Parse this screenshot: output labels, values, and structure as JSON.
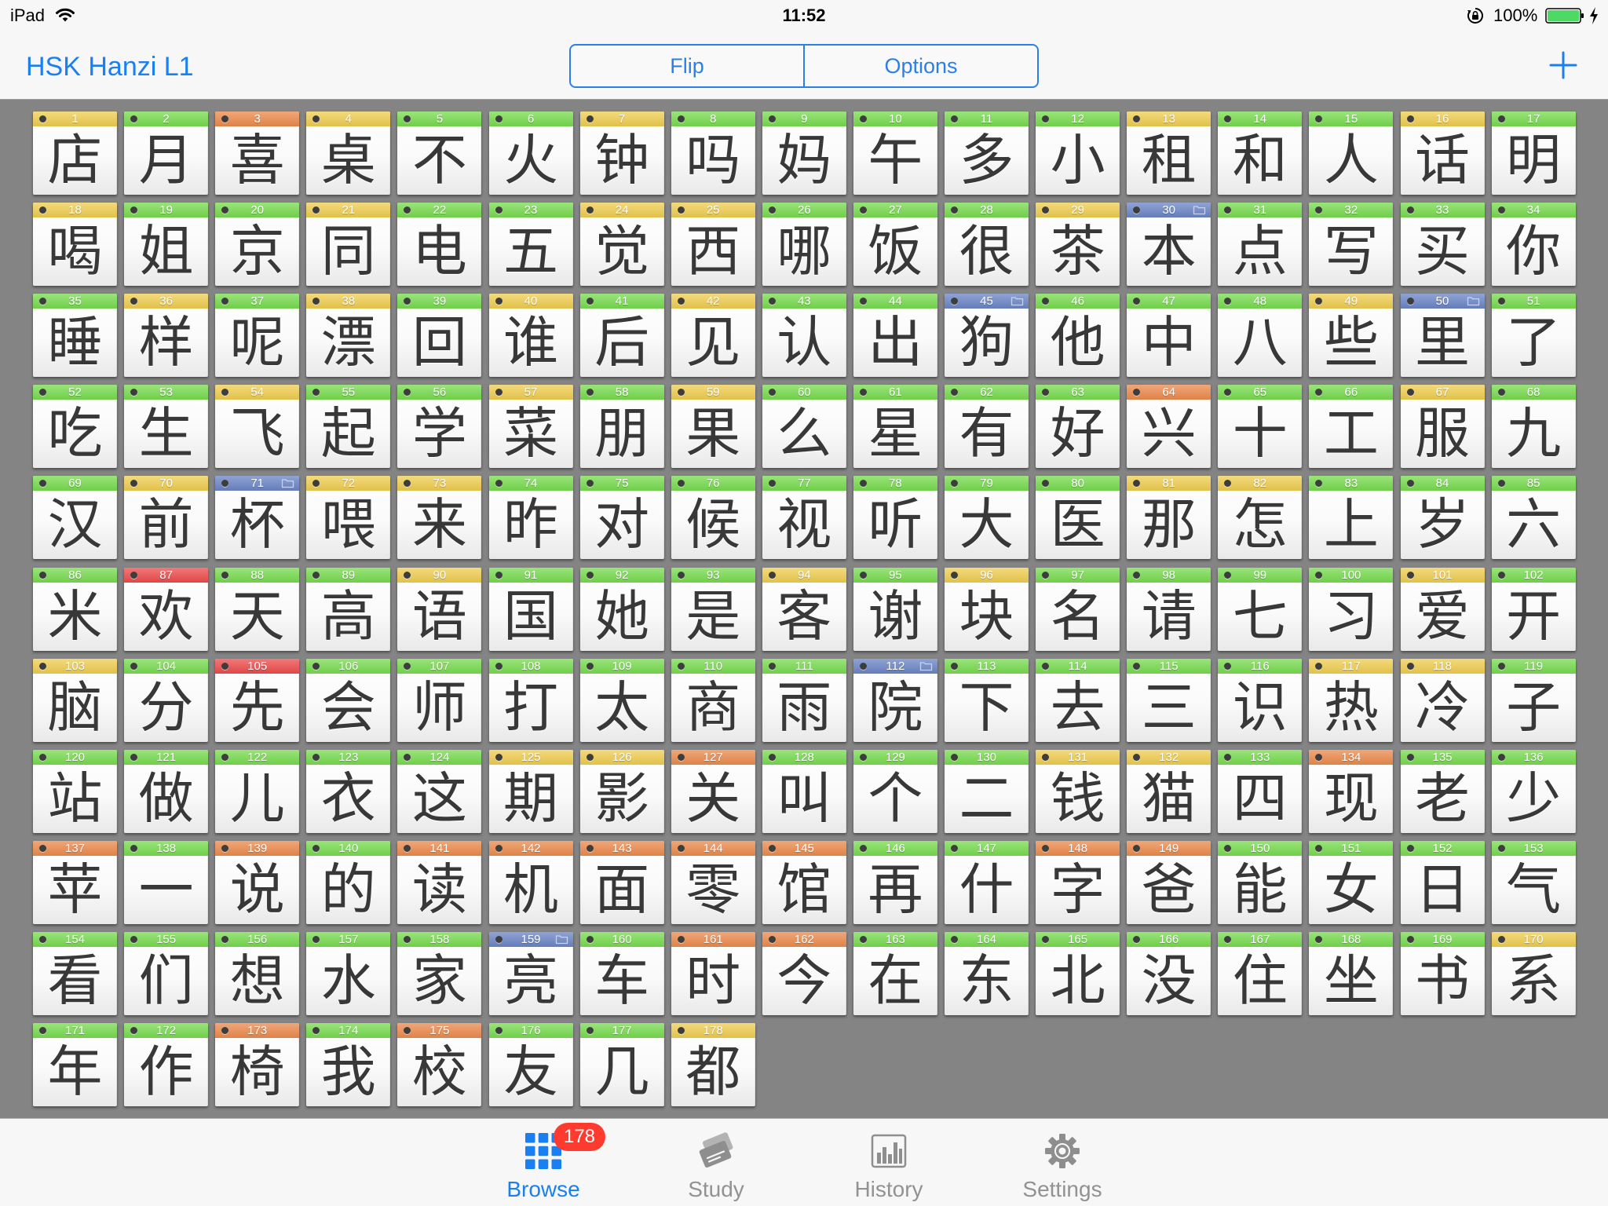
{
  "status_bar": {
    "device": "iPad",
    "time": "11:52",
    "battery": "100%",
    "wifi_icon": "wifi-icon",
    "lock_icon": "rotation-lock-icon",
    "battery_icon": "battery-icon",
    "charging_icon": "bolt-icon"
  },
  "nav": {
    "title": "HSK Hanzi L1",
    "segments": [
      {
        "label": "Flip"
      },
      {
        "label": "Options"
      }
    ],
    "add_icon": "plus-icon"
  },
  "theme": {
    "accent": "#1a7ff0",
    "badge": "#ff3b30",
    "grid_background": "#848484"
  },
  "status_colors": {
    "green": "#77db4e",
    "yellow": "#efcd50",
    "orange": "#ec8a4c",
    "red": "#ee4b4b",
    "blue": "#6a84c6"
  },
  "card_marker": {
    "status": "blue",
    "icon": "folder-icon"
  },
  "cards": [
    {
      "num": "1",
      "char": "店",
      "status": "yellow"
    },
    {
      "num": "2",
      "char": "月",
      "status": "green"
    },
    {
      "num": "3",
      "char": "喜",
      "status": "orange"
    },
    {
      "num": "4",
      "char": "桌",
      "status": "yellow"
    },
    {
      "num": "5",
      "char": "不",
      "status": "green"
    },
    {
      "num": "6",
      "char": "火",
      "status": "green"
    },
    {
      "num": "7",
      "char": "钟",
      "status": "yellow"
    },
    {
      "num": "8",
      "char": "吗",
      "status": "green"
    },
    {
      "num": "9",
      "char": "妈",
      "status": "green"
    },
    {
      "num": "10",
      "char": "午",
      "status": "green"
    },
    {
      "num": "11",
      "char": "多",
      "status": "green"
    },
    {
      "num": "12",
      "char": "小",
      "status": "green"
    },
    {
      "num": "13",
      "char": "租",
      "status": "yellow"
    },
    {
      "num": "14",
      "char": "和",
      "status": "green"
    },
    {
      "num": "15",
      "char": "人",
      "status": "green"
    },
    {
      "num": "16",
      "char": "话",
      "status": "yellow"
    },
    {
      "num": "17",
      "char": "明",
      "status": "green"
    },
    {
      "num": "18",
      "char": "喝",
      "status": "yellow"
    },
    {
      "num": "19",
      "char": "姐",
      "status": "green"
    },
    {
      "num": "20",
      "char": "京",
      "status": "green"
    },
    {
      "num": "21",
      "char": "同",
      "status": "yellow"
    },
    {
      "num": "22",
      "char": "电",
      "status": "green"
    },
    {
      "num": "23",
      "char": "五",
      "status": "green"
    },
    {
      "num": "24",
      "char": "觉",
      "status": "yellow"
    },
    {
      "num": "25",
      "char": "西",
      "status": "yellow"
    },
    {
      "num": "26",
      "char": "哪",
      "status": "green"
    },
    {
      "num": "27",
      "char": "饭",
      "status": "green"
    },
    {
      "num": "28",
      "char": "很",
      "status": "green"
    },
    {
      "num": "29",
      "char": "茶",
      "status": "yellow"
    },
    {
      "num": "30",
      "char": "本",
      "status": "blue"
    },
    {
      "num": "31",
      "char": "点",
      "status": "green"
    },
    {
      "num": "32",
      "char": "写",
      "status": "green"
    },
    {
      "num": "33",
      "char": "买",
      "status": "green"
    },
    {
      "num": "34",
      "char": "你",
      "status": "green"
    },
    {
      "num": "35",
      "char": "睡",
      "status": "green"
    },
    {
      "num": "36",
      "char": "样",
      "status": "yellow"
    },
    {
      "num": "37",
      "char": "呢",
      "status": "green"
    },
    {
      "num": "38",
      "char": "漂",
      "status": "yellow"
    },
    {
      "num": "39",
      "char": "回",
      "status": "green"
    },
    {
      "num": "40",
      "char": "谁",
      "status": "yellow"
    },
    {
      "num": "41",
      "char": "后",
      "status": "green"
    },
    {
      "num": "42",
      "char": "见",
      "status": "yellow"
    },
    {
      "num": "43",
      "char": "认",
      "status": "green"
    },
    {
      "num": "44",
      "char": "出",
      "status": "green"
    },
    {
      "num": "45",
      "char": "狗",
      "status": "blue"
    },
    {
      "num": "46",
      "char": "他",
      "status": "green"
    },
    {
      "num": "47",
      "char": "中",
      "status": "green"
    },
    {
      "num": "48",
      "char": "八",
      "status": "green"
    },
    {
      "num": "49",
      "char": "些",
      "status": "yellow"
    },
    {
      "num": "50",
      "char": "里",
      "status": "blue"
    },
    {
      "num": "51",
      "char": "了",
      "status": "green"
    },
    {
      "num": "52",
      "char": "吃",
      "status": "green"
    },
    {
      "num": "53",
      "char": "生",
      "status": "green"
    },
    {
      "num": "54",
      "char": "飞",
      "status": "yellow"
    },
    {
      "num": "55",
      "char": "起",
      "status": "green"
    },
    {
      "num": "56",
      "char": "学",
      "status": "green"
    },
    {
      "num": "57",
      "char": "菜",
      "status": "yellow"
    },
    {
      "num": "58",
      "char": "朋",
      "status": "green"
    },
    {
      "num": "59",
      "char": "果",
      "status": "yellow"
    },
    {
      "num": "60",
      "char": "么",
      "status": "green"
    },
    {
      "num": "61",
      "char": "星",
      "status": "green"
    },
    {
      "num": "62",
      "char": "有",
      "status": "green"
    },
    {
      "num": "63",
      "char": "好",
      "status": "green"
    },
    {
      "num": "64",
      "char": "兴",
      "status": "orange"
    },
    {
      "num": "65",
      "char": "十",
      "status": "green"
    },
    {
      "num": "66",
      "char": "工",
      "status": "green"
    },
    {
      "num": "67",
      "char": "服",
      "status": "yellow"
    },
    {
      "num": "68",
      "char": "九",
      "status": "green"
    },
    {
      "num": "69",
      "char": "汉",
      "status": "green"
    },
    {
      "num": "70",
      "char": "前",
      "status": "yellow"
    },
    {
      "num": "71",
      "char": "杯",
      "status": "blue"
    },
    {
      "num": "72",
      "char": "喂",
      "status": "yellow"
    },
    {
      "num": "73",
      "char": "来",
      "status": "yellow"
    },
    {
      "num": "74",
      "char": "昨",
      "status": "green"
    },
    {
      "num": "75",
      "char": "对",
      "status": "green"
    },
    {
      "num": "76",
      "char": "候",
      "status": "green"
    },
    {
      "num": "77",
      "char": "视",
      "status": "green"
    },
    {
      "num": "78",
      "char": "听",
      "status": "green"
    },
    {
      "num": "79",
      "char": "大",
      "status": "green"
    },
    {
      "num": "80",
      "char": "医",
      "status": "green"
    },
    {
      "num": "81",
      "char": "那",
      "status": "yellow"
    },
    {
      "num": "82",
      "char": "怎",
      "status": "yellow"
    },
    {
      "num": "83",
      "char": "上",
      "status": "green"
    },
    {
      "num": "84",
      "char": "岁",
      "status": "green"
    },
    {
      "num": "85",
      "char": "六",
      "status": "green"
    },
    {
      "num": "86",
      "char": "米",
      "status": "green"
    },
    {
      "num": "87",
      "char": "欢",
      "status": "red"
    },
    {
      "num": "88",
      "char": "天",
      "status": "green"
    },
    {
      "num": "89",
      "char": "高",
      "status": "green"
    },
    {
      "num": "90",
      "char": "语",
      "status": "yellow"
    },
    {
      "num": "91",
      "char": "国",
      "status": "green"
    },
    {
      "num": "92",
      "char": "她",
      "status": "green"
    },
    {
      "num": "93",
      "char": "是",
      "status": "green"
    },
    {
      "num": "94",
      "char": "客",
      "status": "yellow"
    },
    {
      "num": "95",
      "char": "谢",
      "status": "green"
    },
    {
      "num": "96",
      "char": "块",
      "status": "yellow"
    },
    {
      "num": "97",
      "char": "名",
      "status": "green"
    },
    {
      "num": "98",
      "char": "请",
      "status": "green"
    },
    {
      "num": "99",
      "char": "七",
      "status": "green"
    },
    {
      "num": "100",
      "char": "习",
      "status": "green"
    },
    {
      "num": "101",
      "char": "爱",
      "status": "yellow"
    },
    {
      "num": "102",
      "char": "开",
      "status": "green"
    },
    {
      "num": "103",
      "char": "脑",
      "status": "yellow"
    },
    {
      "num": "104",
      "char": "分",
      "status": "green"
    },
    {
      "num": "105",
      "char": "先",
      "status": "red"
    },
    {
      "num": "106",
      "char": "会",
      "status": "green"
    },
    {
      "num": "107",
      "char": "师",
      "status": "green"
    },
    {
      "num": "108",
      "char": "打",
      "status": "green"
    },
    {
      "num": "109",
      "char": "太",
      "status": "green"
    },
    {
      "num": "110",
      "char": "商",
      "status": "green"
    },
    {
      "num": "111",
      "char": "雨",
      "status": "green"
    },
    {
      "num": "112",
      "char": "院",
      "status": "blue"
    },
    {
      "num": "113",
      "char": "下",
      "status": "green"
    },
    {
      "num": "114",
      "char": "去",
      "status": "green"
    },
    {
      "num": "115",
      "char": "三",
      "status": "green"
    },
    {
      "num": "116",
      "char": "识",
      "status": "green"
    },
    {
      "num": "117",
      "char": "热",
      "status": "yellow"
    },
    {
      "num": "118",
      "char": "冷",
      "status": "yellow"
    },
    {
      "num": "119",
      "char": "子",
      "status": "green"
    },
    {
      "num": "120",
      "char": "站",
      "status": "green"
    },
    {
      "num": "121",
      "char": "做",
      "status": "green"
    },
    {
      "num": "122",
      "char": "儿",
      "status": "green"
    },
    {
      "num": "123",
      "char": "衣",
      "status": "green"
    },
    {
      "num": "124",
      "char": "这",
      "status": "green"
    },
    {
      "num": "125",
      "char": "期",
      "status": "yellow"
    },
    {
      "num": "126",
      "char": "影",
      "status": "yellow"
    },
    {
      "num": "127",
      "char": "关",
      "status": "orange"
    },
    {
      "num": "128",
      "char": "叫",
      "status": "green"
    },
    {
      "num": "129",
      "char": "个",
      "status": "green"
    },
    {
      "num": "130",
      "char": "二",
      "status": "green"
    },
    {
      "num": "131",
      "char": "钱",
      "status": "yellow"
    },
    {
      "num": "132",
      "char": "猫",
      "status": "yellow"
    },
    {
      "num": "133",
      "char": "四",
      "status": "green"
    },
    {
      "num": "134",
      "char": "现",
      "status": "orange"
    },
    {
      "num": "135",
      "char": "老",
      "status": "green"
    },
    {
      "num": "136",
      "char": "少",
      "status": "green"
    },
    {
      "num": "137",
      "char": "苹",
      "status": "orange"
    },
    {
      "num": "138",
      "char": "一",
      "status": "green"
    },
    {
      "num": "139",
      "char": "说",
      "status": "orange"
    },
    {
      "num": "140",
      "char": "的",
      "status": "green"
    },
    {
      "num": "141",
      "char": "读",
      "status": "orange"
    },
    {
      "num": "142",
      "char": "机",
      "status": "orange"
    },
    {
      "num": "143",
      "char": "面",
      "status": "orange"
    },
    {
      "num": "144",
      "char": "零",
      "status": "orange"
    },
    {
      "num": "145",
      "char": "馆",
      "status": "orange"
    },
    {
      "num": "146",
      "char": "再",
      "status": "green"
    },
    {
      "num": "147",
      "char": "什",
      "status": "green"
    },
    {
      "num": "148",
      "char": "字",
      "status": "orange"
    },
    {
      "num": "149",
      "char": "爸",
      "status": "orange"
    },
    {
      "num": "150",
      "char": "能",
      "status": "green"
    },
    {
      "num": "151",
      "char": "女",
      "status": "green"
    },
    {
      "num": "152",
      "char": "日",
      "status": "green"
    },
    {
      "num": "153",
      "char": "气",
      "status": "green"
    },
    {
      "num": "154",
      "char": "看",
      "status": "green"
    },
    {
      "num": "155",
      "char": "们",
      "status": "green"
    },
    {
      "num": "156",
      "char": "想",
      "status": "green"
    },
    {
      "num": "157",
      "char": "水",
      "status": "green"
    },
    {
      "num": "158",
      "char": "家",
      "status": "green"
    },
    {
      "num": "159",
      "char": "亮",
      "status": "blue"
    },
    {
      "num": "160",
      "char": "车",
      "status": "green"
    },
    {
      "num": "161",
      "char": "时",
      "status": "orange"
    },
    {
      "num": "162",
      "char": "今",
      "status": "orange"
    },
    {
      "num": "163",
      "char": "在",
      "status": "green"
    },
    {
      "num": "164",
      "char": "东",
      "status": "green"
    },
    {
      "num": "165",
      "char": "北",
      "status": "green"
    },
    {
      "num": "166",
      "char": "没",
      "status": "green"
    },
    {
      "num": "167",
      "char": "住",
      "status": "green"
    },
    {
      "num": "168",
      "char": "坐",
      "status": "green"
    },
    {
      "num": "169",
      "char": "书",
      "status": "green"
    },
    {
      "num": "170",
      "char": "系",
      "status": "yellow"
    },
    {
      "num": "171",
      "char": "年",
      "status": "green"
    },
    {
      "num": "172",
      "char": "作",
      "status": "green"
    },
    {
      "num": "173",
      "char": "椅",
      "status": "orange"
    },
    {
      "num": "174",
      "char": "我",
      "status": "green"
    },
    {
      "num": "175",
      "char": "校",
      "status": "orange"
    },
    {
      "num": "176",
      "char": "友",
      "status": "green"
    },
    {
      "num": "177",
      "char": "几",
      "status": "green"
    },
    {
      "num": "178",
      "char": "都",
      "status": "yellow"
    }
  ],
  "tabs": [
    {
      "label": "Browse",
      "icon": "grid-icon",
      "selected": true,
      "badge": "178"
    },
    {
      "label": "Study",
      "icon": "cards-icon",
      "selected": false
    },
    {
      "label": "History",
      "icon": "bar-chart-icon",
      "selected": false
    },
    {
      "label": "Settings",
      "icon": "gear-icon",
      "selected": false
    }
  ]
}
